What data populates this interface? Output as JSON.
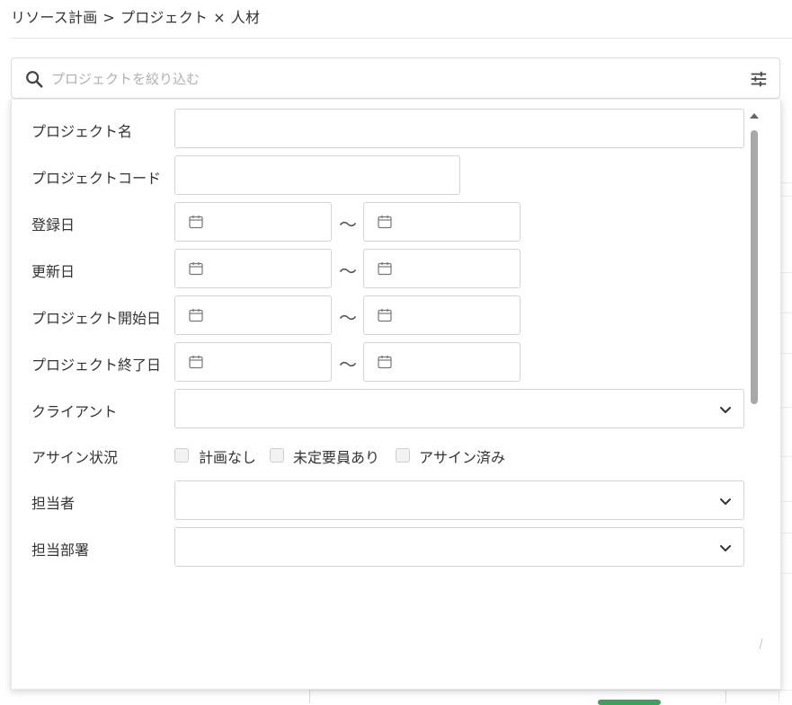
{
  "breadcrumb": {
    "root": "リソース計画",
    "sep1": ">",
    "project": "プロジェクト",
    "sep2": "×",
    "talent": "人材"
  },
  "search": {
    "placeholder": "プロジェクトを絞り込む",
    "value": ""
  },
  "filters": {
    "project_name": {
      "label": "プロジェクト名",
      "value": ""
    },
    "project_code": {
      "label": "プロジェクトコード",
      "value": ""
    },
    "registered_date": {
      "label": "登録日",
      "from": "",
      "to": ""
    },
    "updated_date": {
      "label": "更新日",
      "from": "",
      "to": ""
    },
    "start_date": {
      "label": "プロジェクト開始日",
      "from": "",
      "to": ""
    },
    "end_date": {
      "label": "プロジェクト終了日",
      "from": "",
      "to": ""
    },
    "client": {
      "label": "クライアント",
      "value": ""
    },
    "assign_status": {
      "label": "アサイン状況",
      "options": [
        "計画なし",
        "未定要員あり",
        "アサイン済み"
      ]
    },
    "owner": {
      "label": "担当者",
      "value": ""
    },
    "department": {
      "label": "担当部署",
      "value": ""
    },
    "range_separator": "～"
  },
  "colors": {
    "border": "#d4d4d4",
    "text": "#333333",
    "placeholder": "#b0b0b0",
    "scroll_thumb": "#a8a8a8",
    "accent_pill": "#3aa35a"
  },
  "icons": {
    "search": "search-icon",
    "filter": "sliders-icon",
    "calendar": "calendar-icon",
    "dropdown": "chevron-down-icon",
    "scroll_up": "caret-up-icon"
  }
}
